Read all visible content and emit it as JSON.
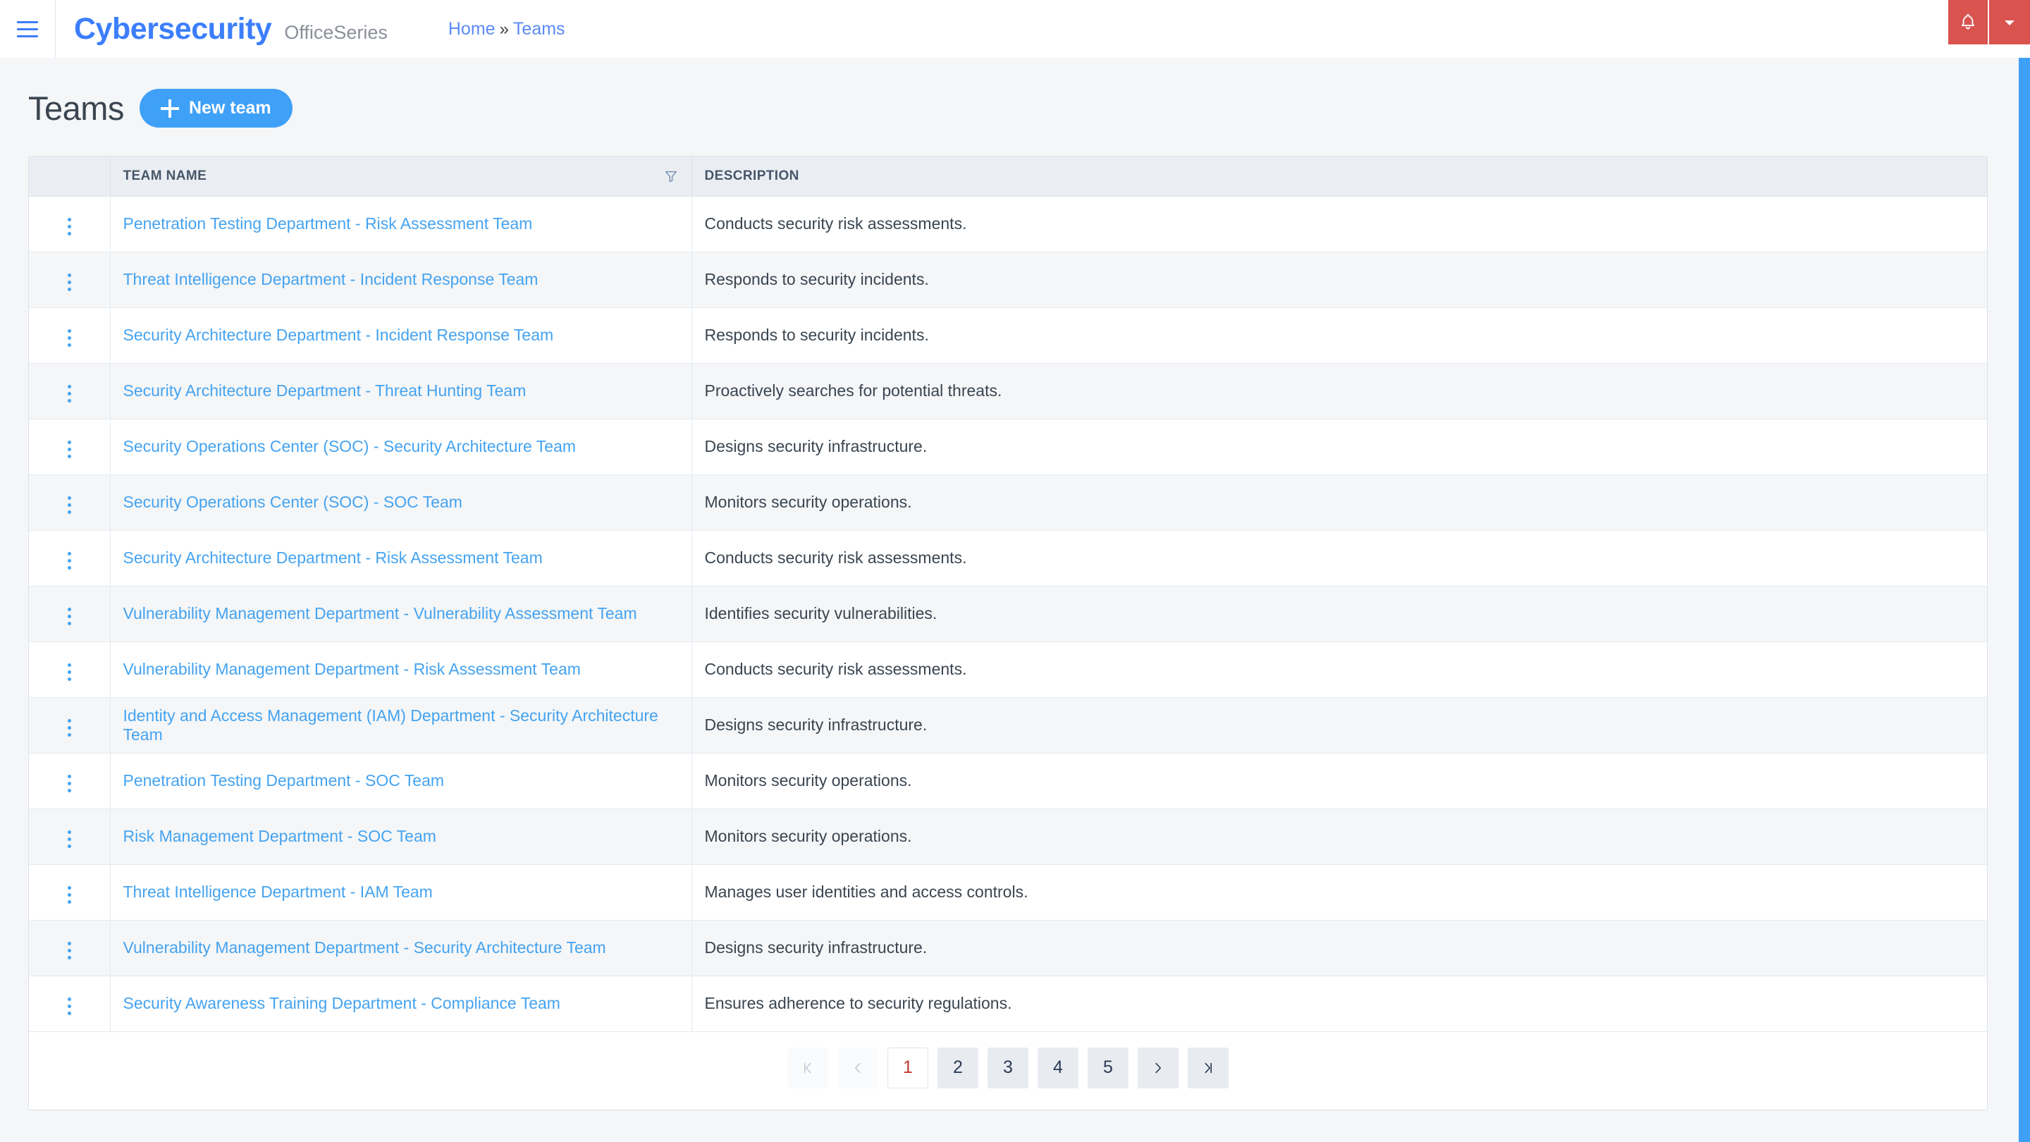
{
  "navbar": {
    "menu_icon": "hamburger-icon",
    "brand_main": "Cybersecurity",
    "brand_sub": "OfficeSeries",
    "breadcrumb": {
      "home": "Home",
      "separator": "»",
      "current": "Teams"
    },
    "notification_icon": "bell-icon",
    "dropdown_icon": "caret-down-icon",
    "accent_color": "#3c7efc",
    "alert_color": "#d9534f"
  },
  "page": {
    "title": "Teams",
    "new_button_label": "New team",
    "new_button_icon": "plus-icon",
    "new_button_color": "#3fa0f7"
  },
  "table": {
    "columns": [
      "",
      "TEAM NAME",
      "DESCRIPTION"
    ],
    "filter_icon": "filter-funnel-icon",
    "row_menu_icon": "vertical-dots-icon",
    "rows": [
      {
        "name": "Penetration Testing Department - Risk Assessment Team",
        "description": "Conducts security risk assessments."
      },
      {
        "name": "Threat Intelligence Department - Incident Response Team",
        "description": "Responds to security incidents."
      },
      {
        "name": "Security Architecture Department - Incident Response Team",
        "description": "Responds to security incidents."
      },
      {
        "name": "Security Architecture Department - Threat Hunting Team",
        "description": "Proactively searches for potential threats."
      },
      {
        "name": "Security Operations Center (SOC) - Security Architecture Team",
        "description": "Designs security infrastructure."
      },
      {
        "name": "Security Operations Center (SOC) - SOC Team",
        "description": "Monitors security operations."
      },
      {
        "name": "Security Architecture Department - Risk Assessment Team",
        "description": "Conducts security risk assessments."
      },
      {
        "name": "Vulnerability Management Department - Vulnerability Assessment Team",
        "description": "Identifies security vulnerabilities."
      },
      {
        "name": "Vulnerability Management Department - Risk Assessment Team",
        "description": "Conducts security risk assessments."
      },
      {
        "name": "Identity and Access Management (IAM) Department - Security Architecture Team",
        "description": "Designs security infrastructure."
      },
      {
        "name": "Penetration Testing Department - SOC Team",
        "description": "Monitors security operations."
      },
      {
        "name": "Risk Management Department - SOC Team",
        "description": "Monitors security operations."
      },
      {
        "name": "Threat Intelligence Department - IAM Team",
        "description": "Manages user identities and access controls."
      },
      {
        "name": "Vulnerability Management Department - Security Architecture Team",
        "description": "Designs security infrastructure."
      },
      {
        "name": "Security Awareness Training Department - Compliance Team",
        "description": "Ensures adherence to security regulations."
      }
    ]
  },
  "pagination": {
    "first_label": "|<",
    "prev_label": "<",
    "next_label": ">",
    "last_label": ">|",
    "pages": [
      "1",
      "2",
      "3",
      "4",
      "5"
    ],
    "active_page": "1",
    "active_color": "#c43a32"
  }
}
